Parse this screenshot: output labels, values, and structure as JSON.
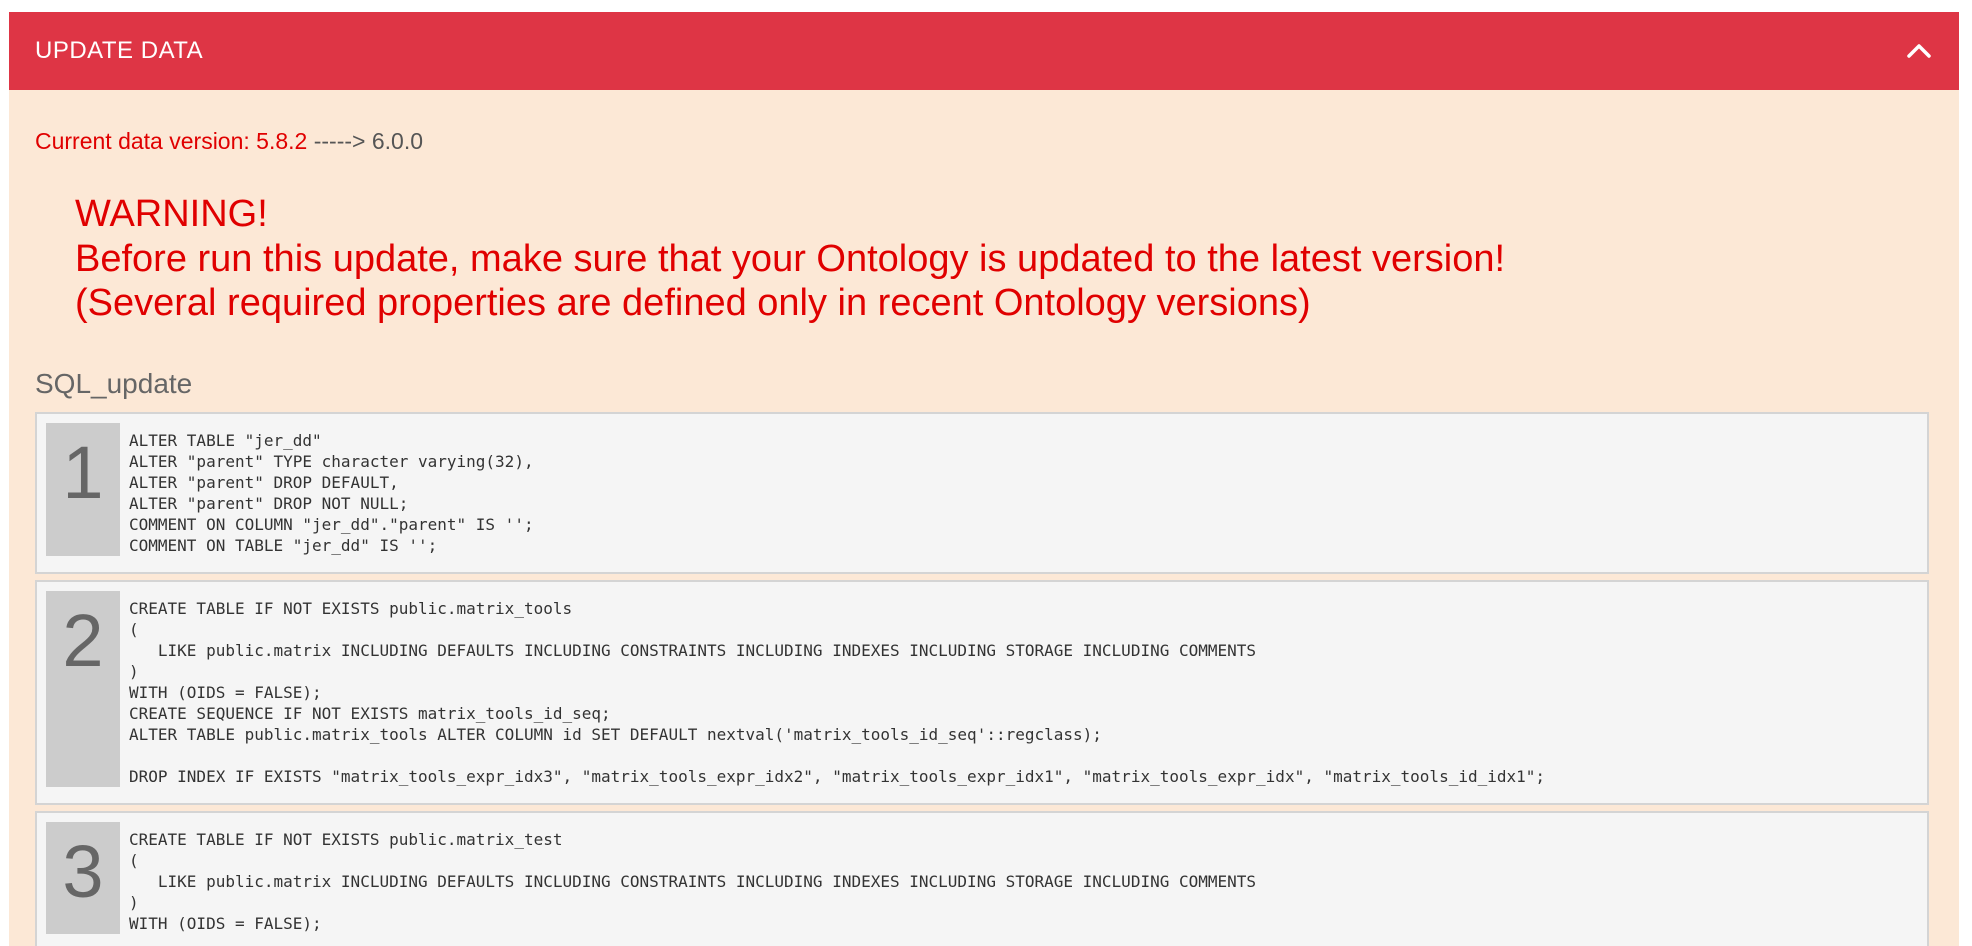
{
  "panel": {
    "title": "UPDATE DATA",
    "collapse_icon": "chevron-up-icon",
    "header_color": "#de3545",
    "background_color": "#fce8d6"
  },
  "version": {
    "current_label": "Current data version: 5.8.2",
    "arrow": " -----> ",
    "new_version": "6.0.0"
  },
  "warning": {
    "line1": "WARNING!",
    "line2": "Before run this update, make sure that your Ontology is updated to the latest version!",
    "line3": "(Several required properties are defined only in recent Ontology versions)"
  },
  "sql_section": {
    "title": "SQL_update",
    "blocks": [
      {
        "number": "1",
        "code": "ALTER TABLE \"jer_dd\"\nALTER \"parent\" TYPE character varying(32),\nALTER \"parent\" DROP DEFAULT,\nALTER \"parent\" DROP NOT NULL;\nCOMMENT ON COLUMN \"jer_dd\".\"parent\" IS '';\nCOMMENT ON TABLE \"jer_dd\" IS '';"
      },
      {
        "number": "2",
        "code": "CREATE TABLE IF NOT EXISTS public.matrix_tools\n(\n   LIKE public.matrix INCLUDING DEFAULTS INCLUDING CONSTRAINTS INCLUDING INDEXES INCLUDING STORAGE INCLUDING COMMENTS\n)\nWITH (OIDS = FALSE);\nCREATE SEQUENCE IF NOT EXISTS matrix_tools_id_seq;\nALTER TABLE public.matrix_tools ALTER COLUMN id SET DEFAULT nextval('matrix_tools_id_seq'::regclass);\n\nDROP INDEX IF EXISTS \"matrix_tools_expr_idx3\", \"matrix_tools_expr_idx2\", \"matrix_tools_expr_idx1\", \"matrix_tools_expr_idx\", \"matrix_tools_id_idx1\";"
      },
      {
        "number": "3",
        "code": "CREATE TABLE IF NOT EXISTS public.matrix_test\n(\n   LIKE public.matrix INCLUDING DEFAULTS INCLUDING CONSTRAINTS INCLUDING INDEXES INCLUDING STORAGE INCLUDING COMMENTS\n)\nWITH (OIDS = FALSE);"
      }
    ]
  }
}
